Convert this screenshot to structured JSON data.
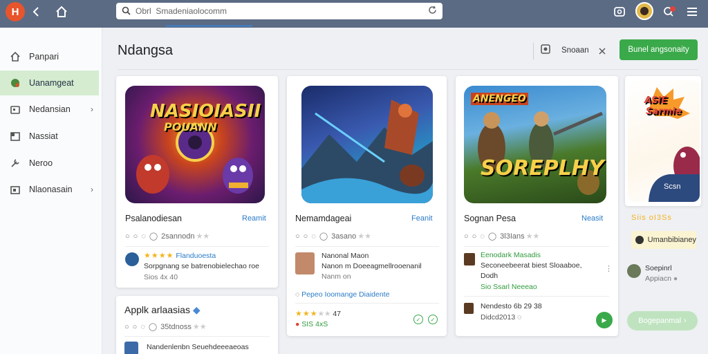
{
  "topbar": {
    "app_icon_letter": "H",
    "search_value": "Obrl  Smadeniaolocomm"
  },
  "sidebar": {
    "items": [
      {
        "label": "Panpari",
        "icon": "home-icon"
      },
      {
        "label": "Uanamgeat",
        "icon": "gamepad-icon"
      },
      {
        "label": "Nedansian",
        "icon": "store-icon"
      },
      {
        "label": "Nassiat",
        "icon": "library-icon"
      },
      {
        "label": "Neroo",
        "icon": "tools-icon"
      },
      {
        "label": "Nlaonasain",
        "icon": "folder-icon"
      }
    ]
  },
  "header": {
    "title": "Ndangsa",
    "right_text": "Snoaan",
    "button_label": "Bunel angsonaity"
  },
  "cards": [
    {
      "art_title": "NASIOIASII",
      "art_subtitle": "POUANN",
      "name": "Psalanodiesan",
      "link": "Reamit",
      "meta": "2sannodn",
      "review_label": "Flanduoesta",
      "review_text": "Sorpgnang se batrenobielechao roe",
      "review_sub": "Sios 4x 40"
    },
    {
      "name": "Nemamdageai",
      "link": "Feanit",
      "meta": "3asano",
      "reviewer": "Nanonal Maon",
      "review_text": "Nanon m Doeeagmellrooenanil",
      "review_sub": "Nanm on",
      "footer_text": "Pepeo Ioomange Diaidente",
      "rating_count": "47",
      "sub_stat": "SIS 4xS"
    },
    {
      "art_title": "ANENGEO",
      "art_subtitle": "SOREPLHY",
      "name": "Sognan Pesa",
      "link": "Neasit",
      "meta": "3l3Ians",
      "reviewer": "Eenodark  Masadis",
      "review_text": "Seconeebeerat biest Sloaaboe,",
      "review_sub": "Dodh",
      "review_sub2": "Sio Ssarl  Neeeao",
      "second_reviewer": "Nendesto 6b 29 38",
      "second_sub": "Didcd2013"
    }
  ],
  "card_bottom_left": {
    "name": "Applk arlaasias",
    "meta": "35tdnoss",
    "review_text": "Nandenlenbn Seuehdeeeaeoas"
  },
  "right_panel": {
    "art_title": "ASIE",
    "art_subtitle": "Sarmie",
    "logo_caption": "Scsn",
    "stat_line": "Siis  oI3Ss",
    "badge": "Umanbibianey",
    "person_name": "Soepinrl",
    "person_sub": "Appiacn",
    "button_label": "Bogepanmal"
  }
}
